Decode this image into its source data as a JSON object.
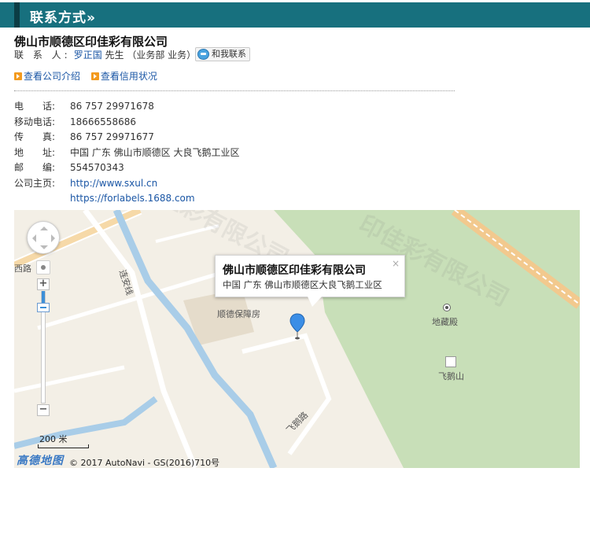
{
  "header": {
    "title": "联系方式»"
  },
  "company": {
    "name": "佛山市顺德区印佳彩有限公司"
  },
  "contact": {
    "label": "联 系 人:",
    "person": "罗正国",
    "title": "先生 （业务部 业务）",
    "button_label": "和我联系"
  },
  "links": [
    {
      "label": "查看公司介绍"
    },
    {
      "label": "查看信用状况"
    }
  ],
  "info": [
    {
      "key": "电　　话:",
      "value": "86 757 29971678"
    },
    {
      "key": "移动电话:",
      "value": "18666558686"
    },
    {
      "key": "传　　真:",
      "value": "86 757 29971677"
    },
    {
      "key": "地　　址:",
      "value": "中国 广东 佛山市顺德区 大良飞鹅工业区"
    },
    {
      "key": "邮　　编:",
      "value": "554570343"
    },
    {
      "key": "公司主页:",
      "value": "http://www.sxul.cn"
    },
    {
      "key": "",
      "value": "https://forlabels.1688.com"
    }
  ],
  "map": {
    "popup": {
      "title": "佛山市顺德区印佳彩有限公司",
      "address": "中国 广东 佛山市顺德区大良飞鹅工业区",
      "close": "×"
    },
    "labels": {
      "road_west": "西路",
      "road_lian_an": "连安线",
      "building": "顺德保障房",
      "temple": "地藏殿",
      "mountain": "飞鹅山",
      "road_fei_e": "飞鹅路"
    },
    "scale": "200 米",
    "logo": "高德地图",
    "copyright": "© 2017 AutoNavi - GS(2016)710号"
  },
  "watermark": "印佳彩有限公司",
  "colors": {
    "header_bg": "#17707e",
    "link": "#1a56a5",
    "park_green": "#c8dfb8",
    "river": "#a9cde8",
    "pin": "#3b8ee6"
  }
}
